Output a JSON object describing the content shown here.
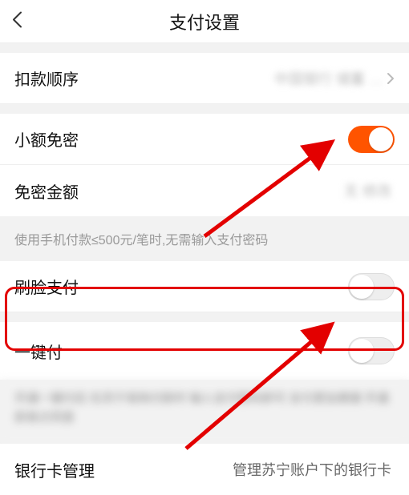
{
  "header": {
    "title": "支付设置"
  },
  "rows": {
    "order": {
      "label": "扣款顺序",
      "value": "中国银行 储蓄 …"
    },
    "smallfree": {
      "label": "小额免密",
      "toggle": true
    },
    "freeamount": {
      "label": "免密金额",
      "value": "无 修改"
    },
    "hint": "使用手机付款≤500元/笔时,无需输入支付密码",
    "facepay": {
      "label": "刷脸支付",
      "toggle": false
    },
    "onekey": {
      "label": "一键付",
      "toggle": false
    },
    "onekey_hint": "开通一键付后 在苏宁易购付款时 输入支付密码即可 支付更加便捷 开通即表示同意",
    "bank": {
      "label": "银行卡管理",
      "value": "管理苏宁账户下的银行卡"
    }
  }
}
